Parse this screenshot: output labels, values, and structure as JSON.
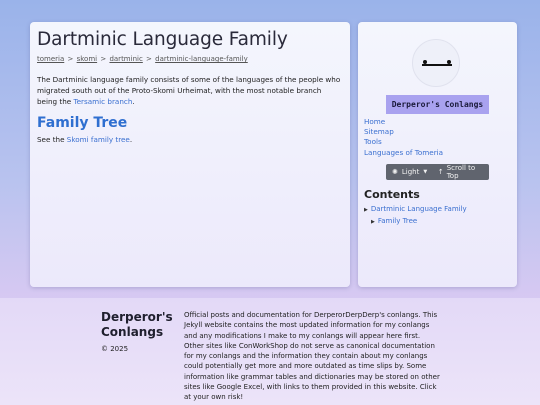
{
  "main": {
    "title": "Dartminic Language Family",
    "breadcrumb": [
      "tomeria",
      "skomi",
      "dartminic",
      "dartminic-language-family"
    ],
    "breadcrumb_sep": ">",
    "intro_text": "The Dartminic language family consists of some of the languages of the people who migrated south out of the Proto-Skomi Urheimat, with the most notable branch being the ",
    "intro_link": "Tersamic branch",
    "intro_end": ".",
    "section_title": "Family Tree",
    "section_text_pre": "See the ",
    "section_link": "Skomi family tree",
    "section_text_post": "."
  },
  "sidebar": {
    "site_name": "Derperor's Conlangs",
    "nav": [
      "Home",
      "Sitemap",
      "Tools",
      "Languages of Tomeria"
    ],
    "theme_label": "Light",
    "scroll_label": "Scroll to Top",
    "contents_title": "Contents",
    "toc": [
      "Dartminic Language Family",
      "Family Tree"
    ]
  },
  "footer": {
    "brand_line1": "Derperor's",
    "brand_line2": "Conlangs",
    "copyright": "© 2025",
    "text": "Official posts and documentation for DerperorDerpDerp's conlangs. This Jekyll website contains the most updated information for my conlangs and any modifications I make to my conlangs will appear here first. Other sites like ConWorkShop do not serve as canonical documentation for my conlangs and the information they contain about my conlangs could potentially get more and more outdated as time slips by. Some information like grammar tables and dictionaries may be stored on other sites like Google Excel, with links to them provided in this website. Click at your own risk!"
  },
  "colors": {
    "link": "#3a6fd0",
    "badge": "#a9a2ef",
    "controls": "#60646e"
  }
}
